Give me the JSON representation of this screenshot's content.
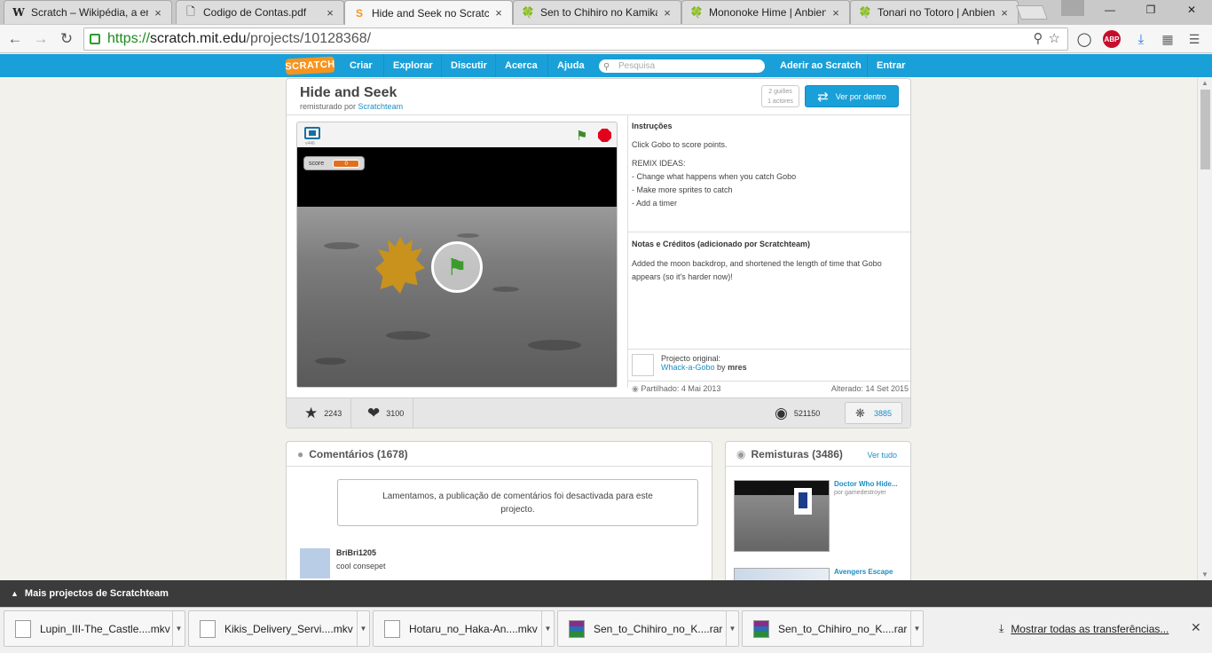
{
  "browser": {
    "tabs": [
      {
        "label": "Scratch – Wikipédia, a en",
        "icon": "wikipedia-icon",
        "glyph": "W",
        "active": false
      },
      {
        "label": "Codigo de Contas.pdf",
        "icon": "document-icon",
        "glyph": "🗋",
        "active": false
      },
      {
        "label": "Hide and Seek no Scratch",
        "icon": "scratch-icon",
        "glyph": "S",
        "active": true
      },
      {
        "label": "Sen to Chihiro no Kamika",
        "icon": "clover-icon",
        "glyph": "🍀",
        "active": false
      },
      {
        "label": "Mononoke Hime | Anbien",
        "icon": "clover-icon",
        "glyph": "🍀",
        "active": false
      },
      {
        "label": "Tonari no Totoro | Anbien",
        "icon": "clover-icon",
        "glyph": "🍀",
        "active": false
      }
    ],
    "url_secure": "https://",
    "url_host": "scratch.mit.edu",
    "url_path": "/projects/10128368/",
    "abp_label": "ABP"
  },
  "scratch_nav": {
    "logo": "SCRATCH",
    "items": [
      "Criar",
      "Explorar",
      "Discutir",
      "Acerca",
      "Ajuda"
    ],
    "search_placeholder": "Pesquisa",
    "join": "Aderir ao Scratch",
    "signin": "Entrar"
  },
  "project": {
    "title": "Hide and Seek",
    "remixed_by_prefix": "remisturado por",
    "remixed_by": "Scratchteam",
    "stats_mini": [
      "2 guiões",
      "1 actores"
    ],
    "see_inside": "Ver por dentro",
    "player_version": "v446",
    "score_label": "score",
    "score_value": "0",
    "instructions_heading": "Instruções",
    "instructions": [
      "Click Gobo to score points.",
      "REMIX IDEAS:",
      "- Change what happens when you catch Gobo",
      "- Make more sprites to catch",
      "- Add a timer"
    ],
    "notes_heading": "Notas e Créditos (adicionado por Scratchteam)",
    "notes": "Added the moon backdrop, and shortened the length of time that Gobo appears (so it's harder now)!",
    "original_label": "Projecto original:",
    "original_project": "Whack-a-Gobo",
    "original_by": "by",
    "original_author": "mres",
    "shared": "Partilhado: 4 Mai 2013",
    "modified": "Alterado: 14 Set 2015",
    "favorites": "2243",
    "loves": "3100",
    "views": "521150",
    "remix_count": "3885"
  },
  "comments": {
    "heading": "Comentários (1678)",
    "disabled_msg": "Lamentamos, a publicação de comentários foi desactivada para este projecto.",
    "items": [
      {
        "user": "BriBri1205",
        "text": "cool consepet"
      }
    ]
  },
  "remixes": {
    "heading": "Remisturas (3486)",
    "see_all": "Ver tudo",
    "items": [
      {
        "title": "Doctor Who Hide...",
        "by": "por gamedestroyer"
      },
      {
        "title": "Avengers Escape",
        "by": ""
      }
    ]
  },
  "more_projects": "Mais projectos de Scratchteam",
  "downloads": {
    "items": [
      {
        "name": "Lupin_III-The_Castle....mkv",
        "type": "mkv"
      },
      {
        "name": "Kikis_Delivery_Servi....mkv",
        "type": "mkv"
      },
      {
        "name": "Hotaru_no_Haka-An....mkv",
        "type": "mkv"
      },
      {
        "name": "Sen_to_Chihiro_no_K....rar",
        "type": "rar"
      },
      {
        "name": "Sen_to_Chihiro_no_K....rar",
        "type": "rar"
      }
    ],
    "show_all": "Mostrar todas as  transferências..."
  }
}
